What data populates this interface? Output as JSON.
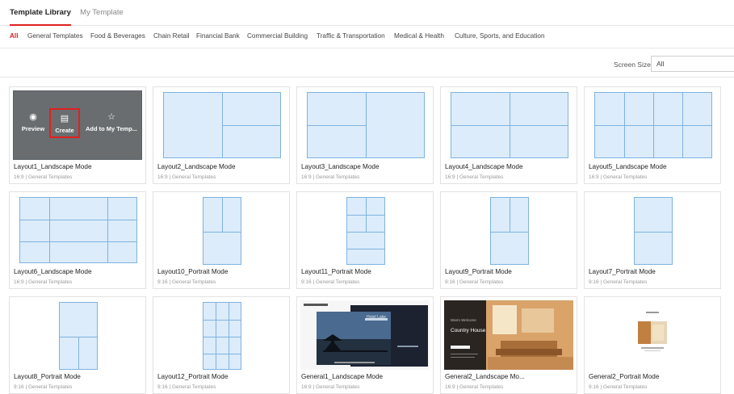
{
  "tabs": {
    "template_library": "Template Library",
    "my_template": "My Template"
  },
  "categories": [
    "All",
    "General Templates",
    "Food & Beverages",
    "Chain Retail",
    "Financial Bank",
    "Commercial Building",
    "Traffic & Transportation",
    "Medical & Health",
    "Culture, Sports, and Education"
  ],
  "screen_size": {
    "label": "Screen Size",
    "value": "All"
  },
  "hover_actions": {
    "preview": "Preview",
    "create": "Create",
    "add": "Add to My Temp..."
  },
  "cards": [
    {
      "title": "Layout1_Landscape Mode",
      "meta": "16:9 | General Templates"
    },
    {
      "title": "Layout2_Landscape Mode",
      "meta": "16:9 | General Templates"
    },
    {
      "title": "Layout3_Landscape Mode",
      "meta": "16:9 | General Templates"
    },
    {
      "title": "Layout4_Landscape Mode",
      "meta": "16:9 | General Templates"
    },
    {
      "title": "Layout5_Landscape Mode",
      "meta": "16:9 | General Templates"
    },
    {
      "title": "Layout6_Landscape Mode",
      "meta": "16:9 | General Templates"
    },
    {
      "title": "Layout10_Portrait Mode",
      "meta": "9:16 | General Templates"
    },
    {
      "title": "Layout11_Portrait Mode",
      "meta": "9:16 | General Templates"
    },
    {
      "title": "Layout9_Portrait Mode",
      "meta": "9:16 | General Templates"
    },
    {
      "title": "Layout7_Portrait Mode",
      "meta": "9:16 | General Templates"
    },
    {
      "title": "Layout8_Portrait Mode",
      "meta": "9:16 | General Templates"
    },
    {
      "title": "Layout12_Portrait Mode",
      "meta": "9:16 | General Templates"
    },
    {
      "title": "General1_Landscape Mode",
      "meta": "16:9 | General Templates"
    },
    {
      "title": "General2_Landscape Mo...",
      "meta": "16:9 | General Templates"
    },
    {
      "title": "General2_Portrait Mode",
      "meta": "9:16 | General Templates"
    }
  ],
  "thumb_text": {
    "g1_title": "Hotel Lake",
    "g2_title": "Country House",
    "g2_kicker": "Warm Welcome"
  },
  "colors": {
    "accent": "#e02020",
    "layout_fill": "#dcecfa",
    "layout_line": "#7fb3e0"
  }
}
